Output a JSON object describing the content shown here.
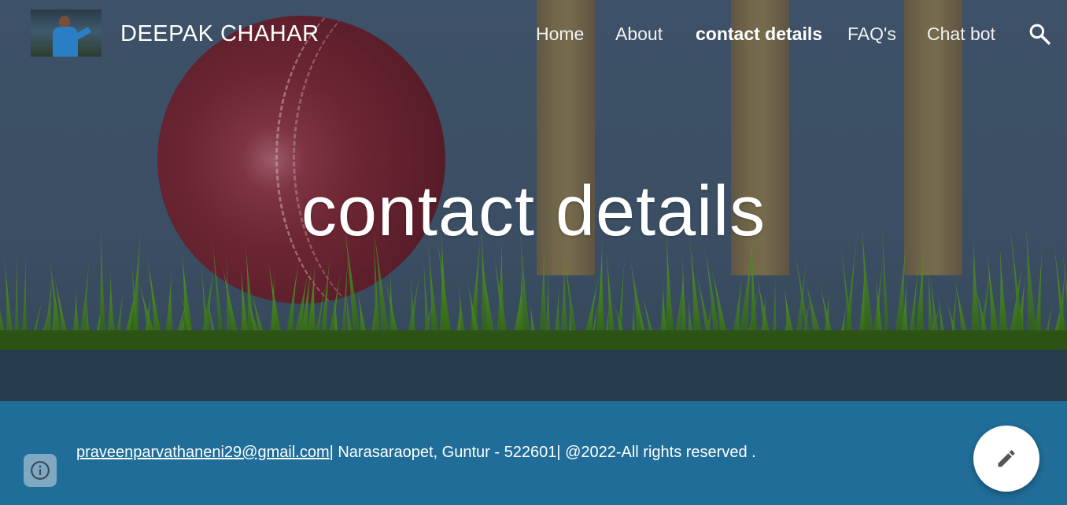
{
  "site": {
    "title": "DEEPAK CHAHAR",
    "logo_icon": "player-photo-icon"
  },
  "nav": {
    "items": [
      {
        "label": "Home",
        "active": false
      },
      {
        "label": "About",
        "active": false
      },
      {
        "label": "contact details",
        "active": true
      },
      {
        "label": "FAQ's",
        "active": false
      },
      {
        "label": "Chat bot",
        "active": false
      }
    ],
    "search_icon": "search-icon"
  },
  "hero": {
    "title": "contact details",
    "background": "cricket-ball-stumps-grass-image"
  },
  "footer": {
    "email": "praveenparvathaneni29@gmail.com",
    "text": "| Narasaraopet, Guntur - 522601| @2022-All rights reserved ."
  },
  "buttons": {
    "info_icon": "info-icon",
    "edit_icon": "pencil-icon"
  },
  "colors": {
    "header_bg": "#3d5168",
    "footer_bg": "#1f6d98",
    "text": "#ffffff"
  }
}
